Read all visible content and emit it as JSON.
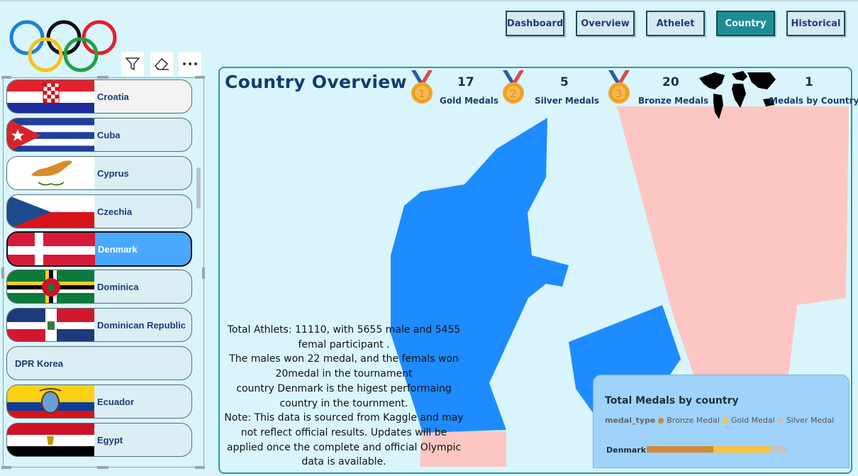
{
  "nav": {
    "dashboard": "Dashboard",
    "overview": "Overview",
    "athlete": "Athelet",
    "country": "Country",
    "historical": "Historical"
  },
  "slicer": {
    "items": [
      {
        "label": "Croatia"
      },
      {
        "label": "Cuba"
      },
      {
        "label": "Cyprus"
      },
      {
        "label": "Czechia"
      },
      {
        "label": "Denmark",
        "selected": true
      },
      {
        "label": "Dominica"
      },
      {
        "label": "Dominican Republic"
      },
      {
        "label": "DPR Korea"
      },
      {
        "label": "Ecuador"
      },
      {
        "label": "Egypt"
      }
    ]
  },
  "panel": {
    "title": "Country Overview",
    "kpis": {
      "gold": {
        "value": "17",
        "label": "Gold Medals"
      },
      "silver": {
        "value": "5",
        "label": "Silver Medals"
      },
      "bronze": {
        "value": "20",
        "label": "Bronze Medals"
      },
      "countries": {
        "value": "1",
        "label": "Medals by Country"
      }
    },
    "note_lines": [
      "Total Athlets: 11110, with 5655 male and 5455",
      "femal participant .",
      "The males won 22 medal, and the femals won",
      "20medal in the tournament",
      "country Denmark is the higest performaing",
      "country in the tournment.",
      "Note: This data is sourced from Kaggle and may",
      "not reflect official results. Updates will be",
      "applied once the complete and official Olympic",
      "data is available."
    ]
  },
  "colors": {
    "background": "#d9f5fb",
    "accent": "#1f8c96",
    "map_blue": "#1e8bff",
    "map_pink": "#fcc6c2",
    "bronze": "#d48833",
    "gold": "#fcc23a",
    "silver": "#c3c3c3"
  },
  "chart_data": {
    "type": "bar",
    "orientation": "horizontal",
    "stacked": true,
    "title": "Total Medals by country",
    "legend_title": "medal_type",
    "categories": [
      "Denmark"
    ],
    "series": [
      {
        "name": "Bronze Medal",
        "values": [
          20
        ]
      },
      {
        "name": "Gold Medal",
        "values": [
          17
        ]
      },
      {
        "name": "Silver Medal",
        "values": [
          5
        ]
      }
    ]
  }
}
